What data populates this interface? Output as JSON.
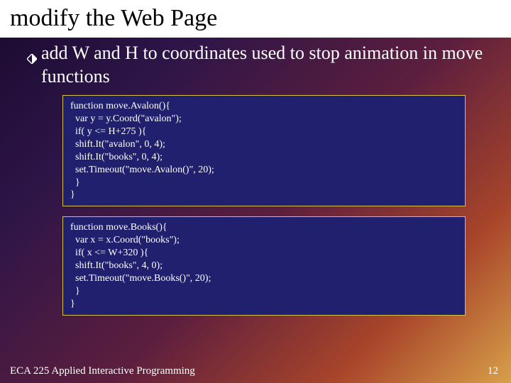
{
  "title": "modify the Web Page",
  "bullet": "add W and H to coordinates used to stop animation in move functions",
  "code1": "function move.Avalon(){\n  var y = y.Coord(\"avalon\");\n  if( y <= H+275 ){\n  shift.It(\"avalon\", 0, 4);\n  shift.It(\"books\", 0, 4);\n  set.Timeout(\"move.Avalon()\", 20);\n  }\n}",
  "code2": "function move.Books(){\n  var x = x.Coord(\"books\");\n  if( x <= W+320 ){\n  shift.It(\"books\", 4, 0);\n  set.Timeout(\"move.Books()\", 20);\n  }\n}",
  "footer_left": "ECA 225   Applied Interactive Programming",
  "footer_right": "12"
}
